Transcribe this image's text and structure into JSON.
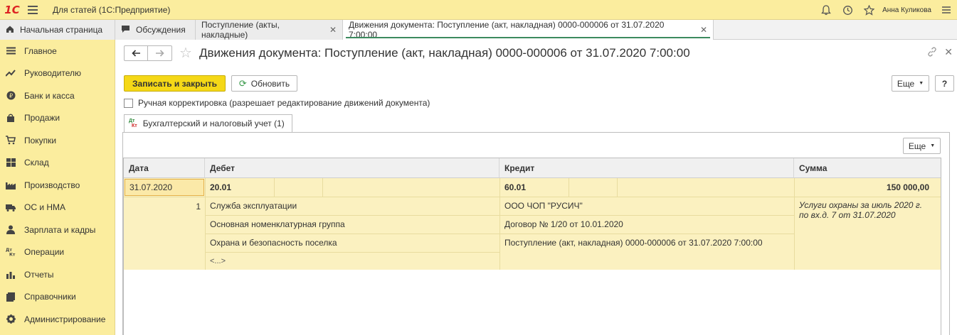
{
  "app": {
    "logo": "1С",
    "title": "Для статей  (1С:Предприятие)",
    "user": "Анна Куликова"
  },
  "tabs": [
    {
      "label": "Начальная страница"
    },
    {
      "label": "Обсуждения"
    },
    {
      "label": "Поступление (акты, накладные)"
    },
    {
      "label": "Движения документа: Поступление (акт, накладная) 0000-000006 от 31.07.2020 7:00:00"
    }
  ],
  "sidebar": {
    "items": [
      {
        "label": "Главное"
      },
      {
        "label": "Руководителю"
      },
      {
        "label": "Банк и касса"
      },
      {
        "label": "Продажи"
      },
      {
        "label": "Покупки"
      },
      {
        "label": "Склад"
      },
      {
        "label": "Производство"
      },
      {
        "label": "ОС и НМА"
      },
      {
        "label": "Зарплата и кадры"
      },
      {
        "label": "Операции"
      },
      {
        "label": "Отчеты"
      },
      {
        "label": "Справочники"
      },
      {
        "label": "Администрирование"
      }
    ]
  },
  "document": {
    "title": "Движения документа: Поступление (акт, накладная) 0000-000006 от 31.07.2020 7:00:00"
  },
  "toolbar": {
    "save_close": "Записать и закрыть",
    "refresh": "Обновить",
    "more": "Еще",
    "help": "?"
  },
  "manual_correction": {
    "label": "Ручная корректировка (разрешает редактирование движений документа)",
    "checked": false
  },
  "register_tab": {
    "icon_top": "Дт",
    "icon_bottom": "Кт",
    "label": "Бухгалтерский и налоговый учет (1)"
  },
  "table": {
    "more": "Еще",
    "headers": [
      "Дата",
      "Дебет",
      "Кредит",
      "Сумма"
    ],
    "row": {
      "date": "31.07.2020",
      "line_number": "1",
      "debit_account": "20.01",
      "credit_account": "60.01",
      "amount": "150 000,00",
      "debit_subconto": [
        "Служба эксплуатации",
        "Основная номенклатурная группа",
        "Охрана и безопасность поселка",
        "<...>"
      ],
      "credit_subconto": [
        "ООО ЧОП \"РУСИЧ\"",
        "Договор № 1/20 от 10.01.2020",
        "Поступление (акт, накладная) 0000-000006 от 31.07.2020 7:00:00"
      ],
      "content": "Услуги охраны за июль 2020 г. по вх.д. 7 от 31.07.2020"
    }
  }
}
